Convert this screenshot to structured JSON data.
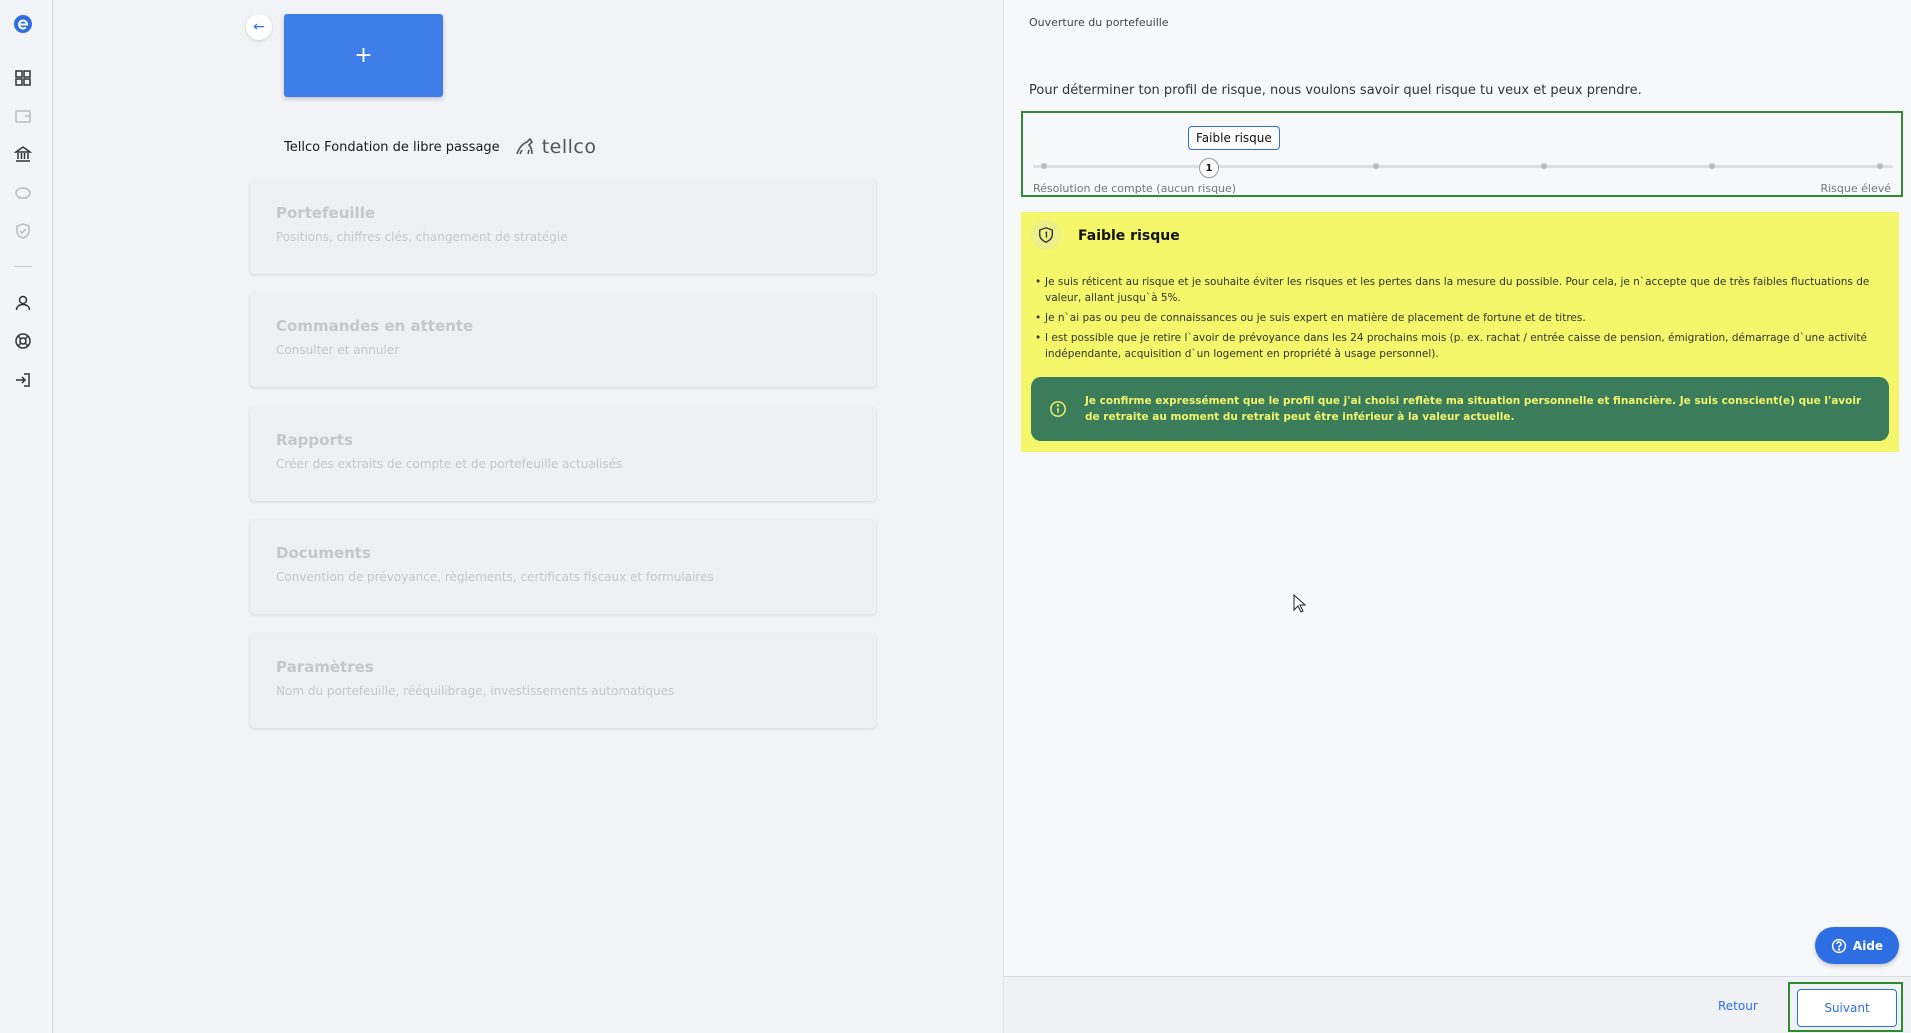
{
  "sidebar": {
    "icons": [
      "app-logo-icon",
      "dashboard-icon",
      "wallet-icon",
      "bank-icon",
      "piggy-bank-icon",
      "shield-icon",
      "user-icon",
      "lifebuoy-icon",
      "logout-icon"
    ]
  },
  "left": {
    "back_icon": "←",
    "add_label": "+",
    "foundation_name": "Tellco Fondation de libre passage",
    "brand": "tellco",
    "cards": [
      {
        "title": "Portefeuille",
        "subtitle": "Positions, chiffres clés, changement de stratégie"
      },
      {
        "title": "Commandes en attente",
        "subtitle": "Consulter et annuler"
      },
      {
        "title": "Rapports",
        "subtitle": "Créer des extraits de compte et de portefeuille actualisés"
      },
      {
        "title": "Documents",
        "subtitle": "Convention de prévoyance, règlements, certificats fiscaux et formulaires"
      },
      {
        "title": "Paramètres",
        "subtitle": "Nom du portefeuille, rééquilibrage, investissements automatiques"
      }
    ]
  },
  "right": {
    "title": "Ouverture du portefeuille",
    "intro": "Pour déterminer ton profil de risque, nous voulons savoir quel risque tu veux et peux prendre.",
    "slider": {
      "tooltip": "Faible risque",
      "value": "1",
      "steps": 6,
      "selected_index": 1,
      "label_left": "Résolution de compte (aucun risque)",
      "label_right": "Risque élevé"
    },
    "risk": {
      "title": "Faible risque",
      "items": [
        "Je suis réticent au risque et je souhaite éviter les risques et les pertes dans la mesure du possible. Pour cela, je n`accepte que de très faibles fluctuations de valeur, allant jusqu`à 5%.",
        "Je n`ai pas ou peu de connaissances ou je suis expert en matière de placement de fortune et de titres.",
        "I est possible que je retire l`avoir de prévoyance dans les 24 prochains mois (p. ex. rachat / entrée caisse de pension, émigration, démarrage d`une activité indépendante, acquisition d`un logement en propriété à usage personnel)."
      ],
      "confirm": "Je confirme expressément que le profil que j'ai choisi reflète ma situation personnelle et financière. Je suis conscient(e) que l'avoir de retraite au moment du retrait peut être inférieur à la valeur actuelle."
    },
    "help_label": "Aide",
    "footer": {
      "back_label": "Retour",
      "next_label": "Suivant"
    }
  },
  "colors": {
    "accent": "#2d6fe3",
    "risk_bg": "#f4f76a",
    "confirm_bg": "#3b7d5b",
    "highlight": "#2e8b2e"
  }
}
